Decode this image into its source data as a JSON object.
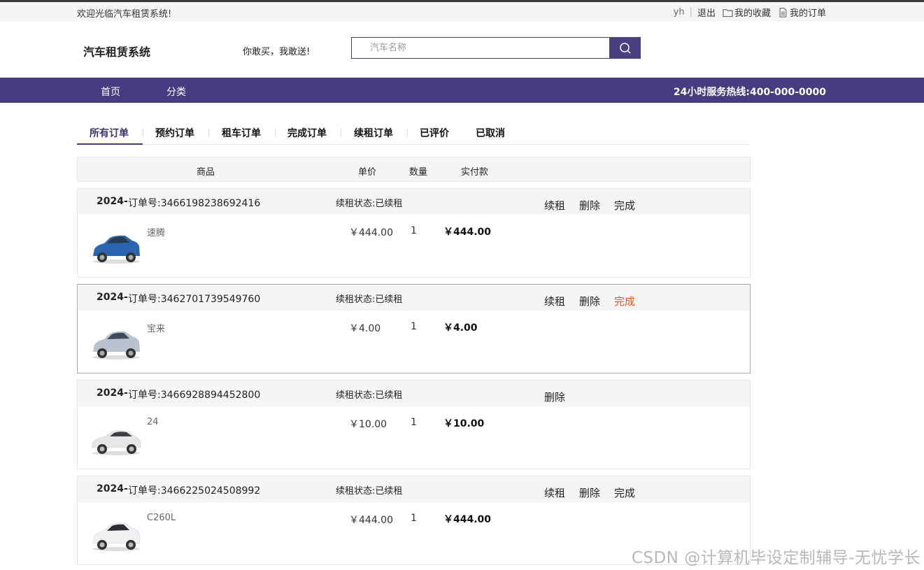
{
  "topbar": {
    "welcome": "欢迎光临汽车租赁系统!",
    "user": "yh",
    "logout": "退出",
    "favorites": "我的收藏",
    "my_orders": "我的订单"
  },
  "header": {
    "logo": "汽车租赁系统",
    "slogan": "你敢买，我敢送!",
    "search_placeholder": "汽车名称"
  },
  "nav": {
    "items": [
      "首页",
      "分类"
    ],
    "hotline": "24小时服务热线:400-000-0000"
  },
  "tabs": [
    "所有订单",
    "预约订单",
    "租车订单",
    "完成订单",
    "续租订单",
    "已评价",
    "已取消"
  ],
  "table_header": {
    "product": "商品",
    "unit_price": "单价",
    "quantity": "数量",
    "paid": "实付款"
  },
  "orders": [
    {
      "year": "2024-",
      "order_no": "订单号:3466198238692416",
      "status": "续租状态:已续租",
      "actions": [
        "续租",
        "删除",
        "完成"
      ],
      "car_name": "速腾",
      "price": "￥444.00",
      "qty": "1",
      "paid": "￥444.00",
      "car_color": "#2a66b0"
    },
    {
      "year": "2024-",
      "order_no": "订单号:3462701739549760",
      "status": "续租状态:已续租",
      "actions": [
        "续租",
        "删除",
        "完成"
      ],
      "car_name": "宝来",
      "price": "￥4.00",
      "qty": "1",
      "paid": "￥4.00",
      "car_color": "#b9c3cf"
    },
    {
      "year": "2024-",
      "order_no": "订单号:3466928894452800",
      "status": "续租状态:已续租",
      "actions": [
        "删除"
      ],
      "car_name": "24",
      "price": "￥10.00",
      "qty": "1",
      "paid": "￥10.00",
      "car_color": "#e6e6e6"
    },
    {
      "year": "2024-",
      "order_no": "订单号:3466225024508992",
      "status": "续租状态:已续租",
      "actions": [
        "续租",
        "删除",
        "完成"
      ],
      "car_name": "C260L",
      "price": "￥444.00",
      "qty": "1",
      "paid": "￥444.00",
      "car_color": "#f0f0f0"
    }
  ],
  "watermark": "CSDN @计算机毕设定制辅导-无忧学长",
  "colors": {
    "accent": "#473c7f",
    "highlight_action": "#e4561e"
  }
}
